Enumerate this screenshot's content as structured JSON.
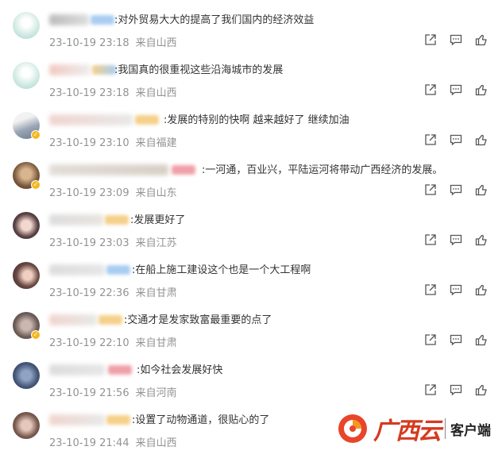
{
  "comments": [
    {
      "text": ":对外贸易大大的提高了我们国内的经济效益",
      "date": "23-10-19 23:18",
      "location": "来自山西"
    },
    {
      "text": ":我国真的很重视这些沿海城市的发展",
      "date": "23-10-19 23:18",
      "location": "来自山西"
    },
    {
      "text": ":发展的特别的快啊  越来越好了  继续加油",
      "date": "23-10-19 23:10",
      "location": "来自福建"
    },
    {
      "text": ":一河通，百业兴，平陆运河将带动广西经济的发展。",
      "date": "23-10-19 23:09",
      "location": "来自山东"
    },
    {
      "text": ":发展更好了",
      "date": "23-10-19 23:03",
      "location": "来自江苏"
    },
    {
      "text": ":在船上施工建设这个也是一个大工程啊",
      "date": "23-10-19 22:36",
      "location": "来自甘肃"
    },
    {
      "text": ":交通才是发家致富最重要的点了",
      "date": "23-10-19 22:10",
      "location": "来自甘肃"
    },
    {
      "text": ":如今社会发展好快",
      "date": "23-10-19 21:56",
      "location": "来自河南"
    },
    {
      "text": ":设置了动物通道，很贴心的了",
      "date": "23-10-19 21:44",
      "location": "来自山西"
    }
  ],
  "watermark": {
    "brand": "广西云",
    "client": "客户端"
  },
  "icons": {
    "share": "share-icon",
    "comment": "comment-icon",
    "like": "like-icon"
  }
}
